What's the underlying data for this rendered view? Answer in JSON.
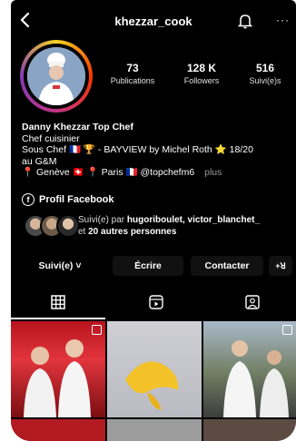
{
  "header": {
    "handle": "khezzar_cook",
    "icons": [
      "back-arrow-icon",
      "bell-icon",
      "more-icon"
    ],
    "more_glyph": "···"
  },
  "stats": [
    {
      "num": "73",
      "label": "Publications"
    },
    {
      "num": "128 K",
      "label": "Followers"
    },
    {
      "num": "516",
      "label": "Suivi(e)s"
    }
  ],
  "bio": {
    "name": "Danny Khezzar Top Chef",
    "line1": "Chef cuisinier",
    "line2a": "Sous Chef 🇫🇷 🏆 - BAYVIEW by Michel Roth ⭐ 18/20",
    "line2b": "au G&M",
    "line3": "📍 Genève 🇨🇭 📍 Paris 🇫🇷 @topchefm6",
    "more": "plus"
  },
  "facebook": {
    "icon_letter": "f",
    "label": "Profil Facebook"
  },
  "followed_by": {
    "prefix": "Suivi(e) par ",
    "names": "hugoriboulet, victor_blanchet_",
    "suffix_pre": "et ",
    "others": "20 autres personnes"
  },
  "actions": {
    "follow": "Suivi(e) ˅",
    "message": "Écrire",
    "contact": "Contacter",
    "add_person": "+ꓤ"
  },
  "tabs": [
    "grid-icon",
    "reels-icon",
    "tagged-icon"
  ]
}
